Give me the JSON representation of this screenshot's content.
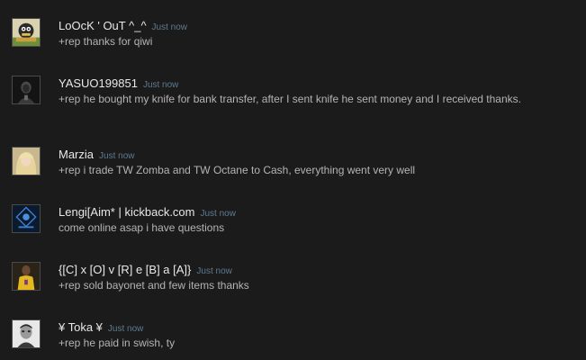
{
  "comments": [
    {
      "author": "LoOcK ' OuT ^_^",
      "time": "Just now",
      "text": "+rep thanks for qiwi",
      "avatar_icon": "cartoon-character-avatar"
    },
    {
      "author": "YASUO199851",
      "time": "Just now",
      "text": "+rep he bought my knife for bank transfer, after I sent knife he sent money and I received thanks.",
      "avatar_icon": "dark-hooded-figure-avatar"
    },
    {
      "author": "Marzia",
      "time": "Just now",
      "text": "+rep i trade TW Zomba and TW Octane to Cash, everything went very well",
      "avatar_icon": "blonde-woman-avatar"
    },
    {
      "author": "Lengi[Aim* | kickback.com",
      "time": "Just now",
      "text": "come online asap i have questions",
      "avatar_icon": "blue-logo-avatar"
    },
    {
      "author": "{[C] x [O] v [R] e [B] a [A]}",
      "time": "Just now",
      "text": "+rep sold bayonet and few items thanks",
      "avatar_icon": "athlete-yellow-jersey-avatar"
    },
    {
      "author": "¥ Toka ¥",
      "time": "Just now",
      "text": "+rep he paid in swish, ty",
      "avatar_icon": "black-white-face-avatar"
    }
  ]
}
